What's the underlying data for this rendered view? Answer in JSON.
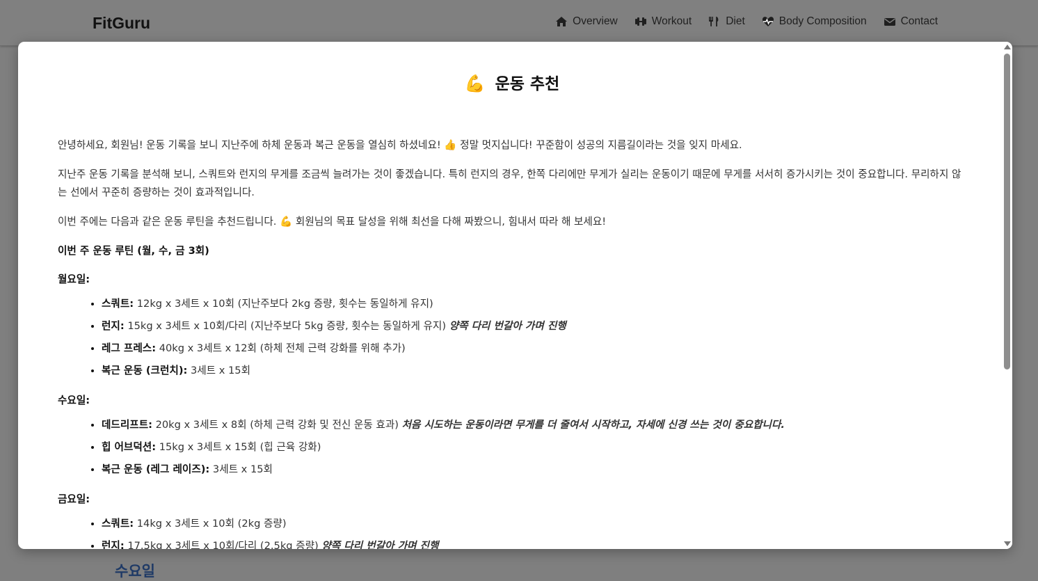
{
  "navbar": {
    "brand": "FitGuru",
    "links": [
      {
        "label": "Overview",
        "icon": "home-icon"
      },
      {
        "label": "Workout",
        "icon": "dumbbell-icon"
      },
      {
        "label": "Diet",
        "icon": "utensils-icon"
      },
      {
        "label": "Body Composition",
        "icon": "heart-pulse-icon"
      },
      {
        "label": "Contact",
        "icon": "envelope-icon"
      }
    ]
  },
  "background": {
    "section_heading": "수요일"
  },
  "modal": {
    "title_emoji": "💪",
    "title": "운동 추천",
    "intro": [
      {
        "before": "안녕하세요, 회원님! 운동 기록을 보니 지난주에 하체 운동과 복근 운동을 열심히 하셨네요!",
        "emoji": "👍",
        "after": "정말 멋지십니다! 꾸준함이 성공의 지름길이라는 것을 잊지 마세요."
      },
      {
        "before": "지난주 운동 기록을 분석해 보니, 스쿼트와 런지의 무게를 조금씩 늘려가는 것이 좋겠습니다. 특히 런지의 경우, 한쪽 다리에만 무게가 실리는 운동이기 때문에 무게를 서서히 증가시키는 것이 중요합니다. 무리하지 않는 선에서 꾸준히 증량하는 것이 효과적입니다.",
        "emoji": "",
        "after": ""
      },
      {
        "before": "이번 주에는 다음과 같은 운동 루틴을 추천드립니다.",
        "emoji": "💪",
        "after": "회원님의 목표 달성을 위해 최선을 다해 짜봤으니, 힘내서 따라 해 보세요!"
      }
    ],
    "routine_heading": "이번 주 운동 루틴 (월, 수, 금 3회)",
    "days": [
      {
        "label": "월요일:",
        "exercises": [
          {
            "name": "스쿼트:",
            "detail": "12kg x 3세트 x 10회 (지난주보다 2kg 증량, 횟수는 동일하게 유지)",
            "note": ""
          },
          {
            "name": "런지:",
            "detail": "15kg x 3세트 x 10회/다리 (지난주보다 5kg 증량, 횟수는 동일하게 유지)",
            "note": "양쪽 다리 번갈아 가며 진행"
          },
          {
            "name": "레그 프레스:",
            "detail": "40kg x 3세트 x 12회 (하체 전체 근력 강화를 위해 추가)",
            "note": ""
          },
          {
            "name": "복근 운동 (크런치):",
            "detail": "3세트 x 15회",
            "note": ""
          }
        ]
      },
      {
        "label": "수요일:",
        "exercises": [
          {
            "name": "데드리프트:",
            "detail": "20kg x 3세트 x 8회 (하체 근력 강화 및 전신 운동 효과)",
            "note": "처음 시도하는 운동이라면 무게를 더 줄여서 시작하고, 자세에 신경 쓰는 것이 중요합니다."
          },
          {
            "name": "힙 어브덕션:",
            "detail": "15kg x 3세트 x 15회 (힙 근육 강화)",
            "note": ""
          },
          {
            "name": "복근 운동 (레그 레이즈):",
            "detail": "3세트 x 15회",
            "note": ""
          }
        ]
      },
      {
        "label": "금요일:",
        "exercises": [
          {
            "name": "스쿼트:",
            "detail": "14kg x 3세트 x 10회 (2kg 증량)",
            "note": ""
          },
          {
            "name": "런지:",
            "detail": "17.5kg x 3세트 x 10회/다리 (2.5kg 증량)",
            "note": "양쪽 다리 번갈아 가며 진행"
          }
        ]
      }
    ]
  }
}
